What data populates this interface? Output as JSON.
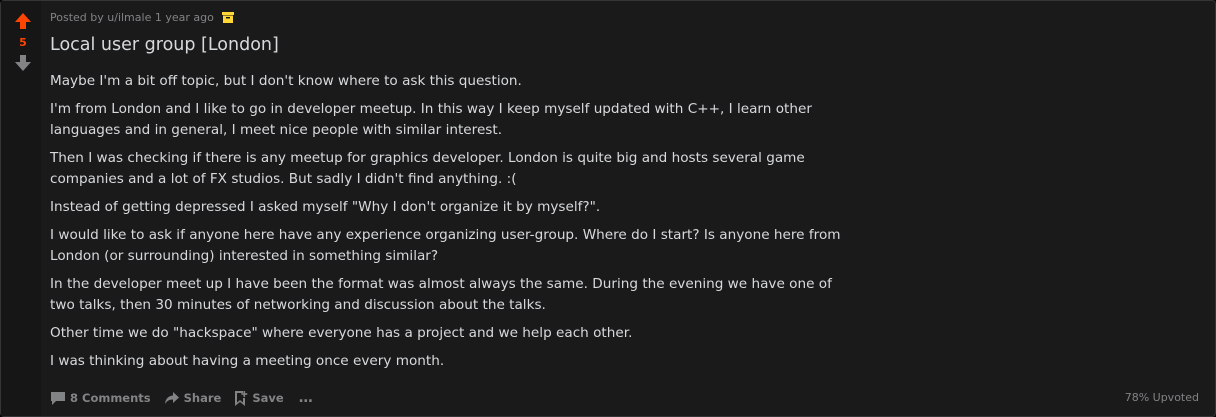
{
  "colors": {
    "background": "#1a1a1b",
    "upvote": "#ff4500",
    "text": "#d7dadc",
    "muted": "#818384",
    "archive_badge": "#ffd635"
  },
  "vote": {
    "count": "5",
    "up_icon": "upvote-arrow-icon",
    "down_icon": "downvote-arrow-icon"
  },
  "post": {
    "posted_by_prefix": "Posted by",
    "author": "u/ilmale",
    "age": "1 year ago",
    "archive_icon": "archive-icon",
    "title": "Local user group [London]",
    "paragraphs": [
      "Maybe I'm a bit off topic, but I don't know where to ask this question.",
      "I'm from London and I like to go in developer meetup. In this way I keep myself updated with C++, I learn other languages and in general, I meet nice people with similar interest.",
      "Then I was checking if there is any meetup for graphics developer. London is quite big and hosts several game companies and a lot of FX studios. But sadly I didn't find anything. :(",
      "Instead of getting depressed I asked myself \"Why I don't organize it by myself?\".",
      "I would like to ask if anyone here have any experience organizing user-group. Where do I start? Is anyone here from London (or surrounding) interested in something similar?",
      "In the developer meet up I have been the format was almost always the same. During the evening we have one of two talks, then 30 minutes of networking and discussion about the talks.",
      "Other time we do \"hackspace\" where everyone has a project and we help each other.",
      "I was thinking about having a meeting once every month."
    ]
  },
  "footer": {
    "comments_label": "8 Comments",
    "share_label": "Share",
    "save_label": "Save",
    "more_label": "…",
    "upvoted_ratio": "78% Upvoted"
  }
}
